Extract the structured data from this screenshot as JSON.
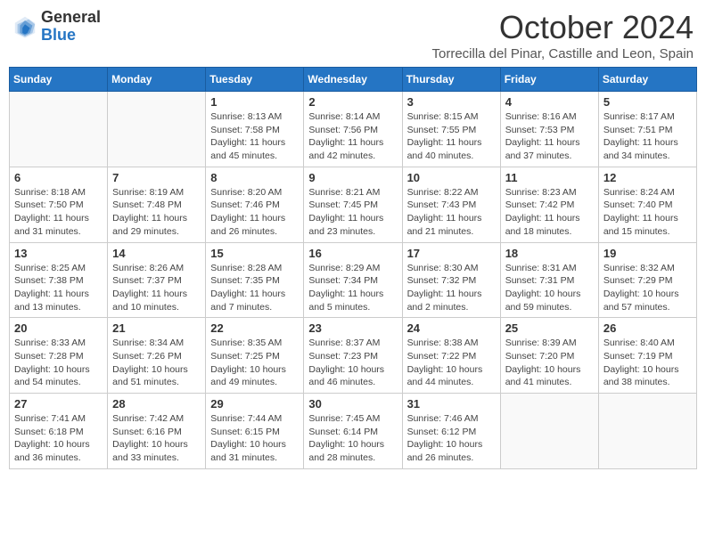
{
  "logo": {
    "general": "General",
    "blue": "Blue"
  },
  "title": "October 2024",
  "subtitle": "Torrecilla del Pinar, Castille and Leon, Spain",
  "days_of_week": [
    "Sunday",
    "Monday",
    "Tuesday",
    "Wednesday",
    "Thursday",
    "Friday",
    "Saturday"
  ],
  "weeks": [
    [
      {
        "day": "",
        "info": ""
      },
      {
        "day": "",
        "info": ""
      },
      {
        "day": "1",
        "info": "Sunrise: 8:13 AM\nSunset: 7:58 PM\nDaylight: 11 hours and 45 minutes."
      },
      {
        "day": "2",
        "info": "Sunrise: 8:14 AM\nSunset: 7:56 PM\nDaylight: 11 hours and 42 minutes."
      },
      {
        "day": "3",
        "info": "Sunrise: 8:15 AM\nSunset: 7:55 PM\nDaylight: 11 hours and 40 minutes."
      },
      {
        "day": "4",
        "info": "Sunrise: 8:16 AM\nSunset: 7:53 PM\nDaylight: 11 hours and 37 minutes."
      },
      {
        "day": "5",
        "info": "Sunrise: 8:17 AM\nSunset: 7:51 PM\nDaylight: 11 hours and 34 minutes."
      }
    ],
    [
      {
        "day": "6",
        "info": "Sunrise: 8:18 AM\nSunset: 7:50 PM\nDaylight: 11 hours and 31 minutes."
      },
      {
        "day": "7",
        "info": "Sunrise: 8:19 AM\nSunset: 7:48 PM\nDaylight: 11 hours and 29 minutes."
      },
      {
        "day": "8",
        "info": "Sunrise: 8:20 AM\nSunset: 7:46 PM\nDaylight: 11 hours and 26 minutes."
      },
      {
        "day": "9",
        "info": "Sunrise: 8:21 AM\nSunset: 7:45 PM\nDaylight: 11 hours and 23 minutes."
      },
      {
        "day": "10",
        "info": "Sunrise: 8:22 AM\nSunset: 7:43 PM\nDaylight: 11 hours and 21 minutes."
      },
      {
        "day": "11",
        "info": "Sunrise: 8:23 AM\nSunset: 7:42 PM\nDaylight: 11 hours and 18 minutes."
      },
      {
        "day": "12",
        "info": "Sunrise: 8:24 AM\nSunset: 7:40 PM\nDaylight: 11 hours and 15 minutes."
      }
    ],
    [
      {
        "day": "13",
        "info": "Sunrise: 8:25 AM\nSunset: 7:38 PM\nDaylight: 11 hours and 13 minutes."
      },
      {
        "day": "14",
        "info": "Sunrise: 8:26 AM\nSunset: 7:37 PM\nDaylight: 11 hours and 10 minutes."
      },
      {
        "day": "15",
        "info": "Sunrise: 8:28 AM\nSunset: 7:35 PM\nDaylight: 11 hours and 7 minutes."
      },
      {
        "day": "16",
        "info": "Sunrise: 8:29 AM\nSunset: 7:34 PM\nDaylight: 11 hours and 5 minutes."
      },
      {
        "day": "17",
        "info": "Sunrise: 8:30 AM\nSunset: 7:32 PM\nDaylight: 11 hours and 2 minutes."
      },
      {
        "day": "18",
        "info": "Sunrise: 8:31 AM\nSunset: 7:31 PM\nDaylight: 10 hours and 59 minutes."
      },
      {
        "day": "19",
        "info": "Sunrise: 8:32 AM\nSunset: 7:29 PM\nDaylight: 10 hours and 57 minutes."
      }
    ],
    [
      {
        "day": "20",
        "info": "Sunrise: 8:33 AM\nSunset: 7:28 PM\nDaylight: 10 hours and 54 minutes."
      },
      {
        "day": "21",
        "info": "Sunrise: 8:34 AM\nSunset: 7:26 PM\nDaylight: 10 hours and 51 minutes."
      },
      {
        "day": "22",
        "info": "Sunrise: 8:35 AM\nSunset: 7:25 PM\nDaylight: 10 hours and 49 minutes."
      },
      {
        "day": "23",
        "info": "Sunrise: 8:37 AM\nSunset: 7:23 PM\nDaylight: 10 hours and 46 minutes."
      },
      {
        "day": "24",
        "info": "Sunrise: 8:38 AM\nSunset: 7:22 PM\nDaylight: 10 hours and 44 minutes."
      },
      {
        "day": "25",
        "info": "Sunrise: 8:39 AM\nSunset: 7:20 PM\nDaylight: 10 hours and 41 minutes."
      },
      {
        "day": "26",
        "info": "Sunrise: 8:40 AM\nSunset: 7:19 PM\nDaylight: 10 hours and 38 minutes."
      }
    ],
    [
      {
        "day": "27",
        "info": "Sunrise: 7:41 AM\nSunset: 6:18 PM\nDaylight: 10 hours and 36 minutes."
      },
      {
        "day": "28",
        "info": "Sunrise: 7:42 AM\nSunset: 6:16 PM\nDaylight: 10 hours and 33 minutes."
      },
      {
        "day": "29",
        "info": "Sunrise: 7:44 AM\nSunset: 6:15 PM\nDaylight: 10 hours and 31 minutes."
      },
      {
        "day": "30",
        "info": "Sunrise: 7:45 AM\nSunset: 6:14 PM\nDaylight: 10 hours and 28 minutes."
      },
      {
        "day": "31",
        "info": "Sunrise: 7:46 AM\nSunset: 6:12 PM\nDaylight: 10 hours and 26 minutes."
      },
      {
        "day": "",
        "info": ""
      },
      {
        "day": "",
        "info": ""
      }
    ]
  ]
}
